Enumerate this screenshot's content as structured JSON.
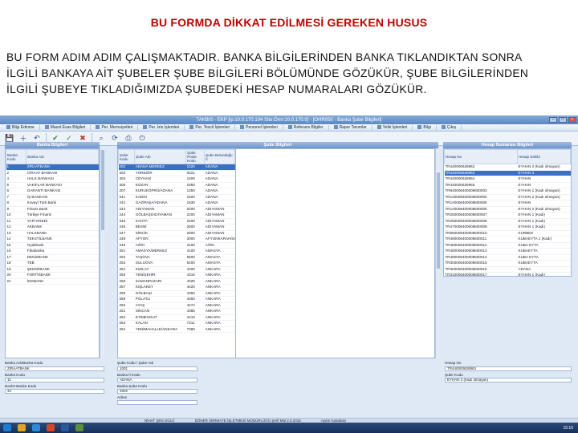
{
  "slide": {
    "title": "BU FORMDA DİKKAT EDİLMESİ GEREKEN HUSUS",
    "body_lines": [
      "BU FORM ADIM ADIM ÇALIŞMAKTADIR. BANKA BİLGİLERİNDEN BANKA TIKLANDIKTAN SONRA",
      "İLGİLİ BANKAYA AİT ŞUBELER ŞUBE BİLGİLERİ BÖLÜMÜNDE GÖZÜKÜR, ŞUBE BİLGİLERİNDEN",
      "İLGİLİ ŞUBEYE TIKLADIĞIMIZDA ŞUBEDEKİ HESAP NUMARALARI GÖZÜKÜR."
    ]
  },
  "window": {
    "title": "TAKBIS - EKP [ip:10.0.170.194 Site:Ömr:10.0.170.0] - [OHR050 - Banka Şube Bilgileri]",
    "menu": [
      "Bilgi Edinme",
      "Mazot Esas Bilgileri",
      "Per. Mernuiyetleri",
      "Per. İzin İşlemleri",
      "Per. Tescil İşlemleri",
      "Personel İşlemleri",
      "Referans Bilgiler",
      "Rapor Tanımlar",
      "Yetki İşlemleri",
      "Bilgi",
      "Çıkış"
    ],
    "colors": {
      "accent": "#3b6fc2",
      "panel_head": "#7fa3d4",
      "title": "#c00000"
    }
  },
  "banks": {
    "header": "Banka Bilgileri",
    "columns": [
      "Banka Kodu",
      "Banka Adı"
    ],
    "rows": [
      [
        "1",
        "ZİRAATBANK"
      ],
      [
        "2",
        "CİRAAT BANKASI"
      ],
      [
        "4",
        "HALK BANKASI"
      ],
      [
        "5",
        "VAKIFLAR BANKASI"
      ],
      [
        "6",
        "GARANTİ BANKASI"
      ],
      [
        "7",
        "İŞ BANKASI"
      ],
      [
        "8",
        "Kuveyt Türk Bank"
      ],
      [
        "9",
        "Finans Bank"
      ],
      [
        "10",
        "Türkiye Finans"
      ],
      [
        "11",
        "YAPI KREDİ"
      ],
      [
        "12",
        "AKBANK"
      ],
      [
        "13",
        "HALKBANK"
      ],
      [
        "14",
        "TEKSTİLBANK"
      ],
      [
        "15",
        "Oyakbank"
      ],
      [
        "16",
        "Fibabanka"
      ],
      [
        "17",
        "DENİZBANK"
      ],
      [
        "18",
        "TEB"
      ],
      [
        "19",
        "ŞEKERBANK"
      ],
      [
        "20",
        "FORTİSBANK"
      ],
      [
        "21",
        "İNGBANK"
      ]
    ],
    "selected_row": 0
  },
  "branches": {
    "header": "Şube Bilgileri",
    "columns": [
      "Şube Kodu",
      "Şube Adı",
      "Şube Posta Kodu",
      "Şube Bulunduğu İl"
    ],
    "rows": [
      [
        "402",
        "ADANA MERKEZ",
        "1020",
        "ADANA"
      ],
      [
        "403",
        "YÜREĞİR",
        "0021",
        "ADANA"
      ],
      [
        "404",
        "CEYHAN",
        "1400",
        "ADANA"
      ],
      [
        "405",
        "KOZAN",
        "1850",
        "ADANA"
      ],
      [
        "207",
        "KURUKÖPRÜ/ADANA",
        "1350",
        "ADANA"
      ],
      [
        "241",
        "KADIN",
        "1920",
        "ADANA"
      ],
      [
        "242",
        "GAZİPAŞA/ADANA",
        "1930",
        "ADANA"
      ],
      [
        "243",
        "ADIYAMAN",
        "0200",
        "ADIYAMAN"
      ],
      [
        "244",
        "GÖLBAŞI/ADIYAMAN",
        "2200",
        "ADIYAMAN"
      ],
      [
        "245",
        "KAHTA",
        "2400",
        "ADIYAMAN"
      ],
      [
        "246",
        "BESNİ",
        "2600",
        "ADIYAMAN"
      ],
      [
        "247",
        "SİNCİK",
        "2800",
        "ADIYAMAN"
      ],
      [
        "248",
        "AFYON",
        "3000",
        "AFYONKARAHİSAR"
      ],
      [
        "249",
        "AĞRI",
        "3100",
        "AĞRI"
      ],
      [
        "251",
        "AMASYA/MERKEZ",
        "4100",
        "AMASYA"
      ],
      [
        "252",
        "TAŞOVA",
        "6600",
        "AMASYA"
      ],
      [
        "253",
        "SULUOVA",
        "5400",
        "AMASYA"
      ],
      [
        "254",
        "KIZILAY",
        "4200",
        "ANKARA"
      ],
      [
        "255",
        "YENİŞEHİR",
        "4316",
        "ANKARA"
      ],
      [
        "256",
        "SAMANPAZARI",
        "4325",
        "ANKARA"
      ],
      [
        "257",
        "KIŞLAKEY",
        "4420",
        "ANKARA"
      ],
      [
        "258",
        "GÖLBAŞI",
        "4350",
        "ANKARA"
      ],
      [
        "259",
        "POLATLI",
        "4260",
        "ANKARA"
      ],
      [
        "260",
        "AYAŞ",
        "4274",
        "ANKARA"
      ],
      [
        "261",
        "SINCAN",
        "4385",
        "ANKARA"
      ],
      [
        "262",
        "ETİMESGUT",
        "4410",
        "ANKARA"
      ],
      [
        "263",
        "KALAN",
        "7311",
        "ANKARA"
      ],
      [
        "264",
        "YENİMAHALLE/ANKARA",
        "7360",
        "ANKARA"
      ]
    ],
    "selected_row": 0
  },
  "accounts": {
    "header": "Hesap Numarası Bilgileri",
    "columns": [
      "Hesap No",
      "Hesap Sahibi"
    ],
    "rows": [
      [
        "TR440000628962",
        "EYHAN 2 (Kadı olmayan)"
      ],
      [
        "TR440000628963",
        "EYHAN 3"
      ],
      [
        "TR440000628964",
        "EYHAN"
      ],
      [
        "TR440000628965",
        "EYHAN"
      ],
      [
        "TR840006400008600003",
        "EYHAN 1 (Kadı olmayan)"
      ],
      [
        "TR140006400008600004",
        "EYHAN 2 (Kadı olmayan)"
      ],
      [
        "TR140006400008600005",
        "EYHAN"
      ],
      [
        "TR140006400008600006",
        "EYHAN 2 (Kadı olmayan)"
      ],
      [
        "TR250006400008600007",
        "EYHAN 1 (Kadı)"
      ],
      [
        "TR250006400008600008",
        "EYHAN 1 (Kadı)"
      ],
      [
        "TR470006400008600009",
        "EYHAN 1 (Kadı)"
      ],
      [
        "TR550006400008600010",
        "KURBEK"
      ],
      [
        "TR480006400008600011",
        "KUBAEYTA 1 (Kadı)"
      ],
      [
        "TR480006400008600012",
        "KUBA EYTA"
      ],
      [
        "TR480006400008600013",
        "KUBAEYTA"
      ],
      [
        "TR480006400008600014",
        "KUBA EYTA"
      ],
      [
        "TR300006400008600015",
        "KUBAEYTA"
      ],
      [
        "TR300006400008600016",
        "ADANA"
      ],
      [
        "TR310006400008600017",
        "EYHAN 1 (Kadı)"
      ],
      [
        "TR310006400008600018",
        "EYHAN 2 (Kadı olmayan)"
      ]
    ],
    "selected_row": 1
  },
  "forms": {
    "bank": {
      "code_label": "Banka Adı/Banka Kodu",
      "code_value": "ZİRAATBANK",
      "sub_label": "Banka Kodu",
      "sub_value": "11",
      "alt_label": "Devlet Banka Kodu",
      "alt_value": "34"
    },
    "branch": {
      "label1": "Şube Kodu / Şube Adı",
      "value1": "1001",
      "label2": "Banka İl Kodu",
      "value2": "ADANA",
      "label3": "Banka Şube Kodu",
      "value3": "4602",
      "label4": "Adres",
      "value4": ""
    },
    "account": {
      "label1": "Hesap No",
      "value1": "TR440000628963",
      "label2": "Şube Kodu",
      "value2": "EYHAN 2 (Kadı olmayan)"
    }
  },
  "status": [
    "NİHAT ŞEN GÜLÜ",
    "DÖNER SERMAYE İŞLETMESİ MÜDÜRLÜĞÜ Şerif Mal 2.5.2016",
    "Aydın Kasabası"
  ],
  "clock": "15:16"
}
